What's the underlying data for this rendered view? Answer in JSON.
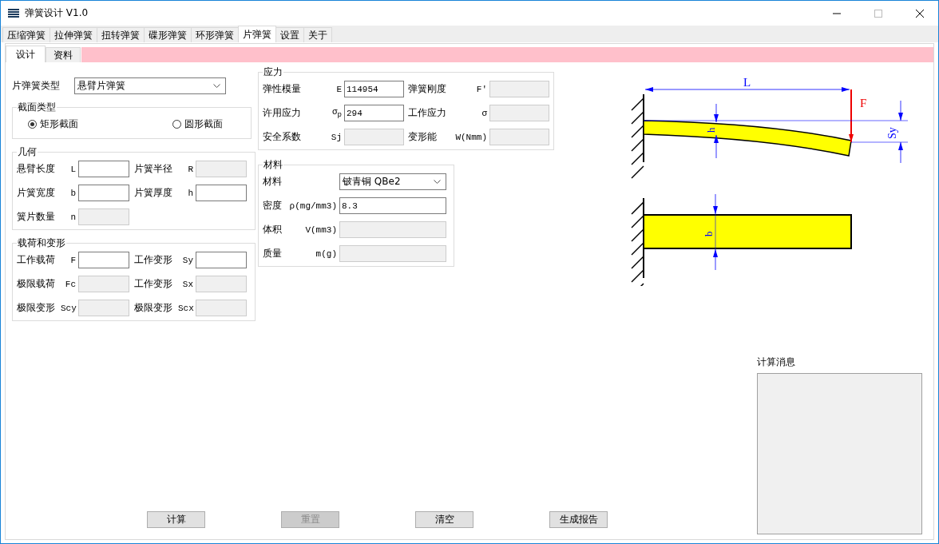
{
  "window": {
    "title": "弹簧设计 V1.0"
  },
  "tabs": [
    {
      "label": "压缩弹簧",
      "selected": false
    },
    {
      "label": "拉伸弹簧",
      "selected": false
    },
    {
      "label": "扭转弹簧",
      "selected": false
    },
    {
      "label": "碟形弹簧",
      "selected": false
    },
    {
      "label": "环形弹簧",
      "selected": false
    },
    {
      "label": "片弹簧",
      "selected": true
    },
    {
      "label": "设置",
      "selected": false
    },
    {
      "label": "关于",
      "selected": false
    }
  ],
  "sub_tabs": [
    {
      "label": "设计",
      "selected": true
    },
    {
      "label": "资料",
      "selected": false
    }
  ],
  "spring_type": {
    "label": "片弹簧类型",
    "value": "悬臂片弹簧"
  },
  "section_type": {
    "title": "截面类型",
    "options": [
      {
        "label": "矩形截面",
        "selected": true
      },
      {
        "label": "圆形截面",
        "selected": false
      }
    ]
  },
  "geometry": {
    "title": "几何",
    "fields": [
      {
        "label": "悬臂长度",
        "symbol": "L",
        "disabled": false
      },
      {
        "label": "片簧半径",
        "symbol": "R",
        "disabled": true
      },
      {
        "label": "片簧宽度",
        "symbol": "b",
        "disabled": false
      },
      {
        "label": "片簧厚度",
        "symbol": "h",
        "disabled": false
      },
      {
        "label": "簧片数量",
        "symbol": "n",
        "disabled": true
      }
    ]
  },
  "load": {
    "title": "载荷和变形",
    "fields": [
      {
        "label": "工作载荷",
        "symbol": "F",
        "disabled": false
      },
      {
        "label": "工作变形",
        "symbol": "Sy",
        "disabled": false
      },
      {
        "label": "极限载荷",
        "symbol": "Fc",
        "disabled": true
      },
      {
        "label": "工作变形",
        "symbol": "Sx",
        "disabled": true
      },
      {
        "label": "极限变形",
        "symbol": "Scy",
        "disabled": true
      },
      {
        "label": "极限变形",
        "symbol": "Scx",
        "disabled": true
      }
    ]
  },
  "stress": {
    "title": "应力",
    "fields": [
      {
        "label": "弹性模量",
        "symbol": "E",
        "value": "114954",
        "disabled": false
      },
      {
        "label": "弹簧刚度",
        "symbol": "F′",
        "disabled": true
      },
      {
        "label": "许用应力",
        "symbol": "σ$_{p}$",
        "value": "294",
        "disabled": false
      },
      {
        "label": "工作应力",
        "symbol": "σ",
        "disabled": true
      },
      {
        "label": "安全系数",
        "symbol": "Sj",
        "disabled": true
      },
      {
        "label": "变形能",
        "symbol": "W(Nmm)",
        "disabled": true
      }
    ]
  },
  "material": {
    "title": "材料",
    "select": {
      "label": "材料",
      "value": "铍青铜 QBe2"
    },
    "fields": [
      {
        "label": "密度",
        "symbol": "ρ(mg/mm3)",
        "value": "8.3",
        "disabled": false
      },
      {
        "label": "体积",
        "symbol": "V(mm3)",
        "disabled": true
      },
      {
        "label": "质量",
        "symbol": "m(g)",
        "disabled": true
      }
    ]
  },
  "diagram": {
    "length_label": "L",
    "force_label": "F",
    "thickness_label": "h",
    "deflection_label": "Sy",
    "width_label": "b"
  },
  "buttons": [
    {
      "label": "计算",
      "disabled": false
    },
    {
      "label": "重置",
      "disabled": true
    },
    {
      "label": "清空",
      "disabled": false
    },
    {
      "label": "生成报告",
      "disabled": false
    }
  ],
  "message_panel": {
    "title": "计算消息"
  }
}
